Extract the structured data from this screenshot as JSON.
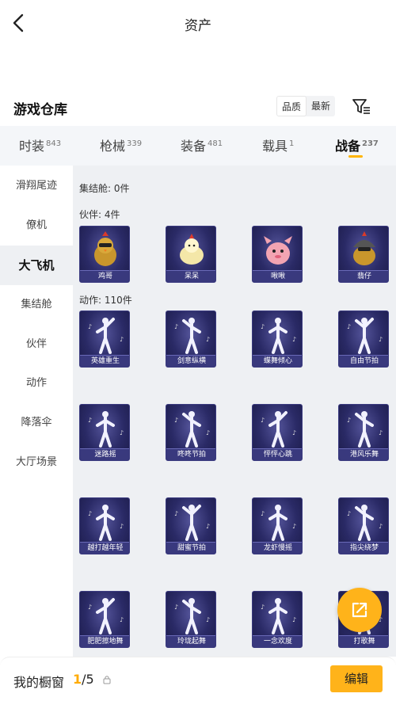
{
  "header": {
    "title": "资产"
  },
  "warehouse": {
    "title": "游戏仓库",
    "sort_quality": "品质",
    "sort_latest": "最新"
  },
  "tabs": [
    {
      "label": "时装",
      "count": "843"
    },
    {
      "label": "枪械",
      "count": "339"
    },
    {
      "label": "装备",
      "count": "481"
    },
    {
      "label": "载具",
      "count": "1"
    },
    {
      "label": "战备",
      "count": "237"
    }
  ],
  "sidebar": [
    "滑翔尾迹",
    "僚机",
    "大飞机",
    "集结舱",
    "伙伴",
    "动作",
    "降落伞",
    "大厅场景"
  ],
  "sections": {
    "pod": "集结舱: 0件",
    "partners": "伙伴: 4件",
    "actions": "动作: 110件"
  },
  "partners": [
    "鸡哥",
    "呆呆",
    "啾啾",
    "翡仔"
  ],
  "actions": [
    "英雄重生",
    "剑意纵横",
    "蝶舞倾心",
    "自由节拍",
    "迷路摇",
    "咚咚节拍",
    "怦怦心跳",
    "港风乐舞",
    "越打越年轻",
    "甜蜜节拍",
    "龙虾慢摇",
    "指尖绕梦",
    "肥肥擦地舞",
    "玲珑起舞",
    "一念欢度",
    "打歌舞"
  ],
  "footer": {
    "showcase": "我的橱窗",
    "current": "1",
    "total": "/5",
    "edit": "编辑"
  },
  "colors": {
    "accent": "#ffb31a",
    "card_bg": "#2a2a66"
  }
}
